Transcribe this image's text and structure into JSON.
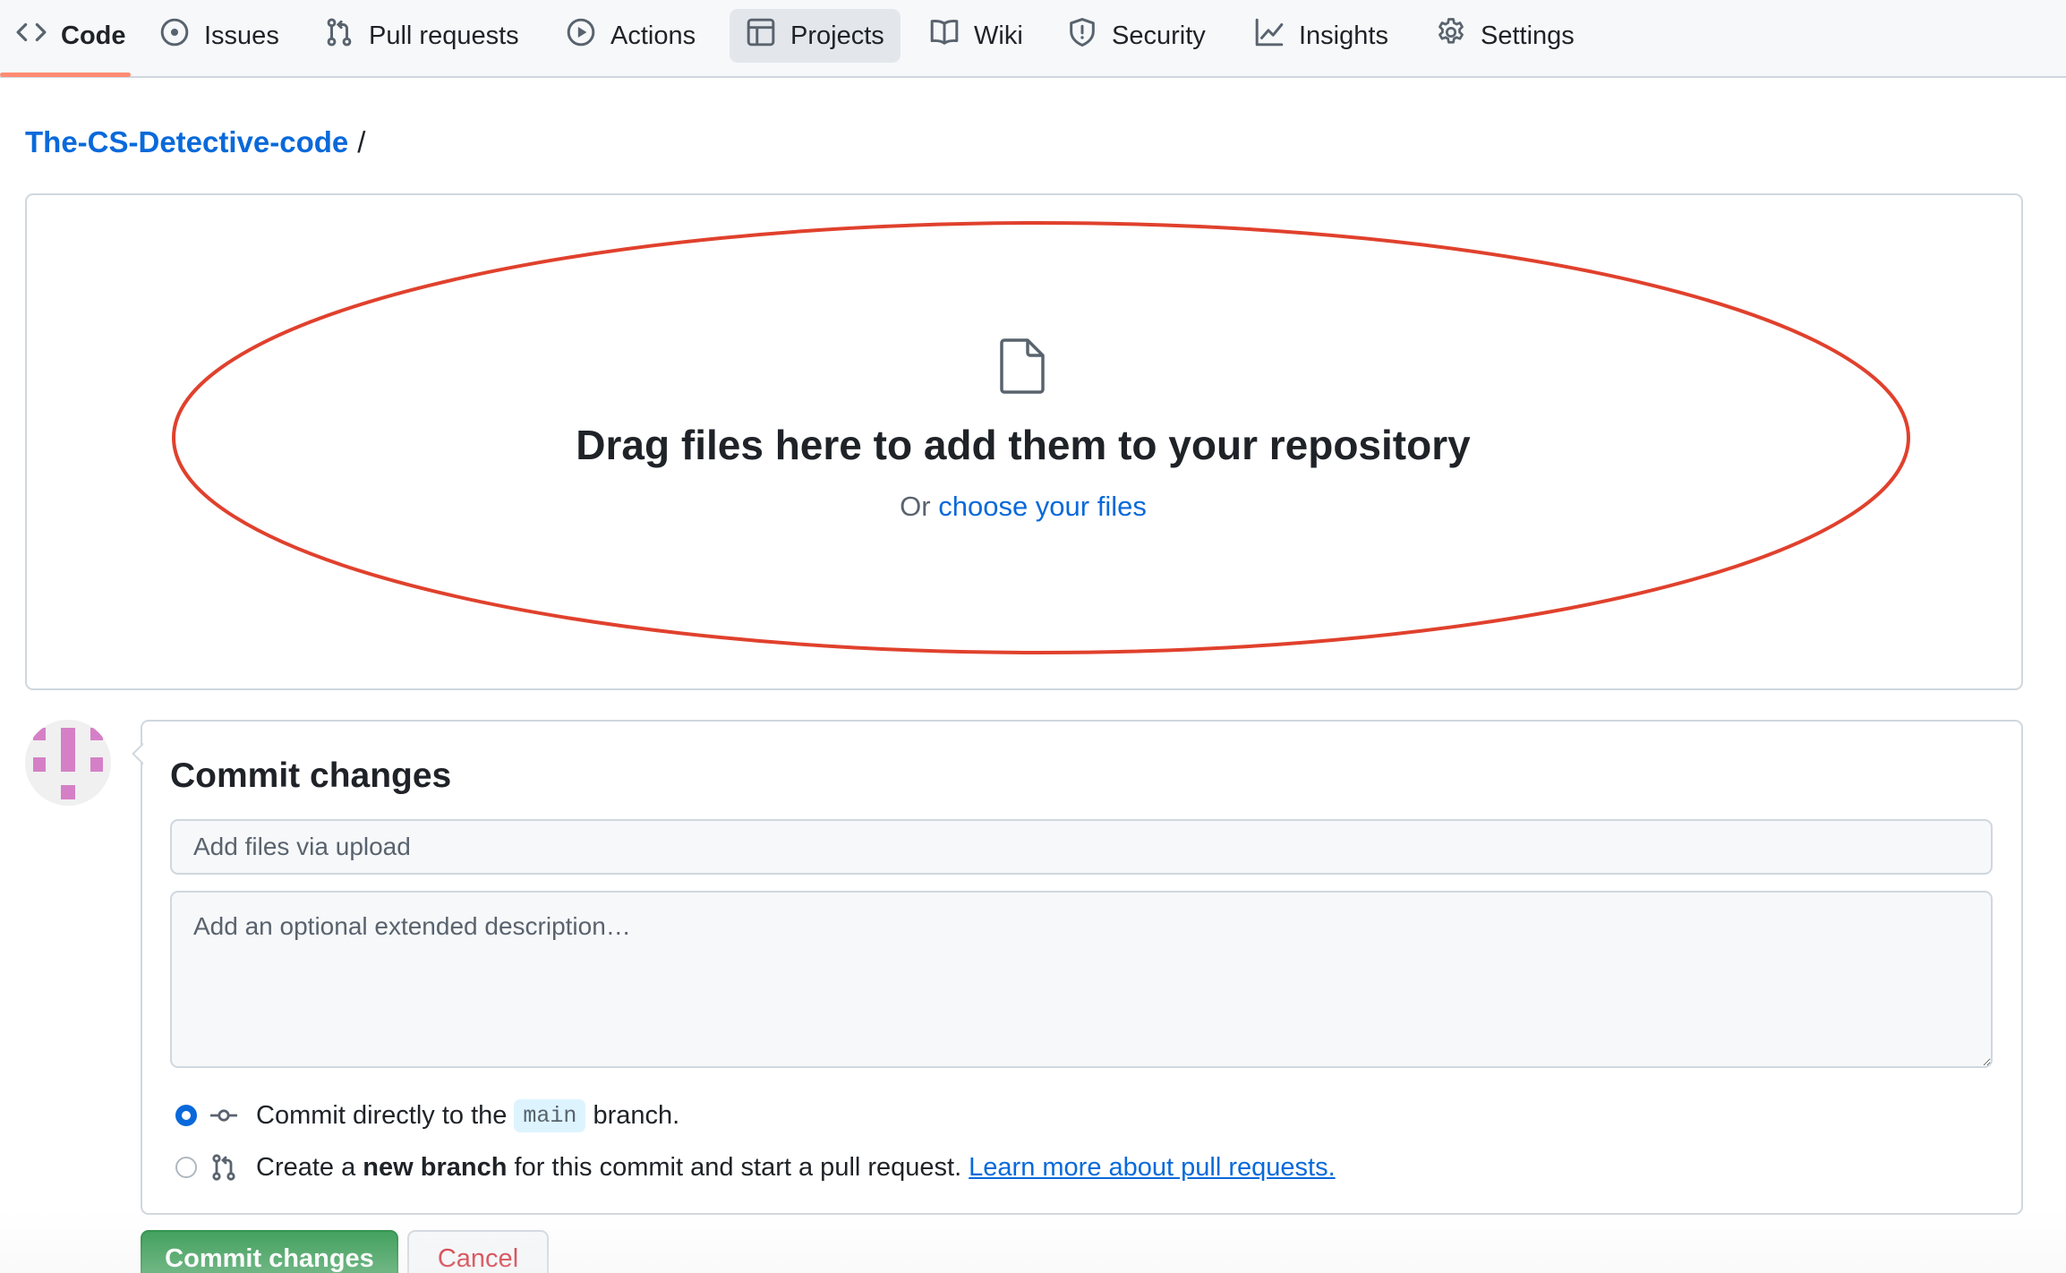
{
  "nav": {
    "tabs": [
      {
        "label": "Code",
        "icon": "code-icon"
      },
      {
        "label": "Issues",
        "icon": "issue-opened-icon"
      },
      {
        "label": "Pull requests",
        "icon": "git-pull-request-icon"
      },
      {
        "label": "Actions",
        "icon": "play-icon"
      },
      {
        "label": "Projects",
        "icon": "table-icon"
      },
      {
        "label": "Wiki",
        "icon": "book-icon"
      },
      {
        "label": "Security",
        "icon": "shield-icon"
      },
      {
        "label": "Insights",
        "icon": "graph-icon"
      },
      {
        "label": "Settings",
        "icon": "gear-icon"
      }
    ],
    "selected_tab": "Code",
    "hovered_tab": "Projects",
    "accent_underline": "#fd8c73"
  },
  "breadcrumb": {
    "repo": "The-CS-Detective-code",
    "separator": "/"
  },
  "dropzone": {
    "icon": "file-icon",
    "title": "Drag files here to add them to your repository",
    "prefix": "Or",
    "link": "choose your files",
    "annotation_color": "#e0412d"
  },
  "commit": {
    "title": "Commit changes",
    "summary_placeholder": "Add files via upload",
    "description_placeholder": "Add an optional extended description…",
    "options": {
      "direct": {
        "prefix": "Commit directly to the",
        "branch": "main",
        "suffix": "branch.",
        "selected": true,
        "icon": "git-commit-icon"
      },
      "new_branch": {
        "prefix": "Create a",
        "bold": "new branch",
        "suffix": "for this commit and start a pull request.",
        "link": "Learn more about pull requests.",
        "selected": false,
        "icon": "git-pull-request-icon"
      }
    }
  },
  "buttons": {
    "commit": "Commit changes",
    "cancel": "Cancel"
  },
  "colors": {
    "link": "#0969da",
    "primary_button": "#2c974b",
    "danger_text": "#d1242f",
    "avatar_pattern": "#d580c6"
  }
}
